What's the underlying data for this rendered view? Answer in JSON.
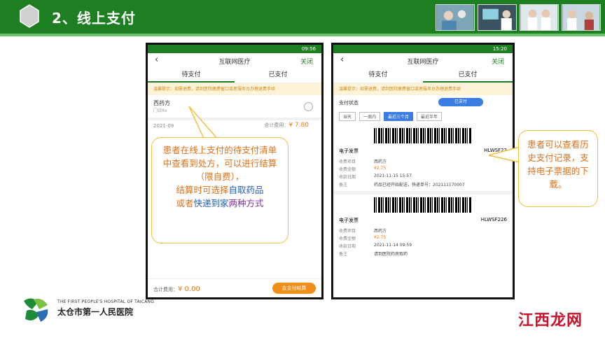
{
  "slide": {
    "title": "2、线上支付"
  },
  "left_phone": {
    "status_time": "09:56",
    "nav_title": "互联网医疗",
    "close": "关闭",
    "tabs": [
      "待支付",
      "已支付"
    ],
    "notice": "温馨提示：如需退费，请到医院缴费窗口或者服务台办理退费手续",
    "item_title": "西药方",
    "item_sub": "门诊Rx",
    "date_prefix": "2021-09",
    "total_label": "合计费用：",
    "total_amount": "¥ 7.80",
    "footer_label": "合计费用：",
    "footer_amount": "¥ 0.00",
    "pay_button": "去支付结算"
  },
  "right_phone": {
    "status_time": "15:20",
    "nav_title": "互联网医疗",
    "close": "关闭",
    "tabs": [
      "待支付",
      "已支付"
    ],
    "notice": "温馨提示：如需退费，请到医院缴费窗口或者服务台办理退费手续",
    "status_label": "支付状态",
    "status_value": "已支付",
    "filters": [
      "当天",
      "一周内",
      "最近三个月",
      "最近半年"
    ],
    "records": [
      {
        "label": "电子发票",
        "code": "HLWSF22",
        "rows": [
          {
            "k": "收费项目",
            "v": "西药方"
          },
          {
            "k": "收费金额",
            "v": "¥2.75"
          },
          {
            "k": "收款日期",
            "v": "2021-11-15 15:57"
          },
          {
            "k": "备注",
            "v": "药品已经开始配送，快递单号：202111170007"
          }
        ]
      },
      {
        "label": "电子发票",
        "code": "HLWSF226",
        "rows": [
          {
            "k": "收费项目",
            "v": "西药方"
          },
          {
            "k": "收费金额",
            "v": "¥2.75"
          },
          {
            "k": "收款日期",
            "v": "2021-11-14 09:59"
          },
          {
            "k": "备注",
            "v": "请到医院药房取药"
          }
        ]
      }
    ]
  },
  "callout_left": {
    "part1": "患者在线上支付的待支付清单中查看到处方，可以进行结算（限自费），",
    "part2": "结算时可选择",
    "part3": "自取药品",
    "part4": "或者",
    "part5": "快递到家",
    "part6": "两种方式"
  },
  "callout_right": {
    "text": "患者可以查看历史支付记录，支持电子票据的下载。"
  },
  "logo": {
    "en": "THE FIRST PEOPLE'S HOSPITAL OF TAICANG",
    "cn": "太仓市第一人民医院"
  },
  "watermark": "江西龙网",
  "colors": {
    "header_green": "#1e7e22",
    "accent_orange": "#f18e1a",
    "blue": "#3b7de3",
    "callout_border": "#f0c040"
  }
}
